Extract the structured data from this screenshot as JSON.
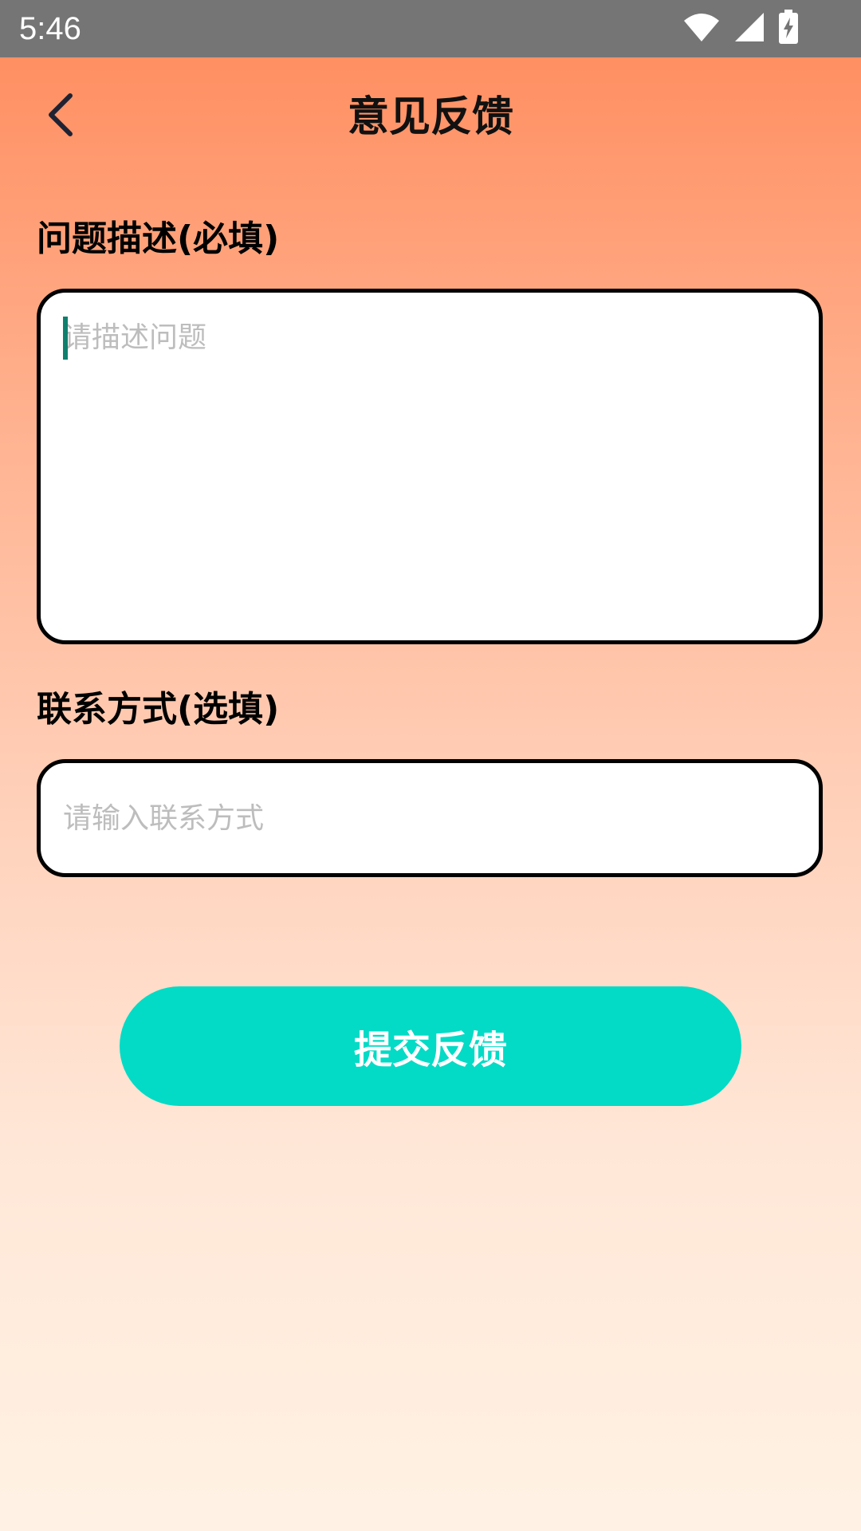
{
  "status_bar": {
    "time": "5:46",
    "icons": [
      "wifi-icon",
      "signal-icon",
      "battery-charging-icon"
    ]
  },
  "header": {
    "title": "意见反馈",
    "back_icon": "chevron-left-icon"
  },
  "description": {
    "label": "问题描述(必填)",
    "placeholder": "请描述问题",
    "value": ""
  },
  "contact": {
    "label": "联系方式(选填)",
    "placeholder": "请输入联系方式",
    "value": ""
  },
  "submit": {
    "label": "提交反馈"
  },
  "colors": {
    "accent": "#03dbc6",
    "gradient_top": "#ff8a5b",
    "gradient_bottom": "#fff2e4",
    "caret": "#0f7f6d",
    "status_bar": "#757575"
  }
}
